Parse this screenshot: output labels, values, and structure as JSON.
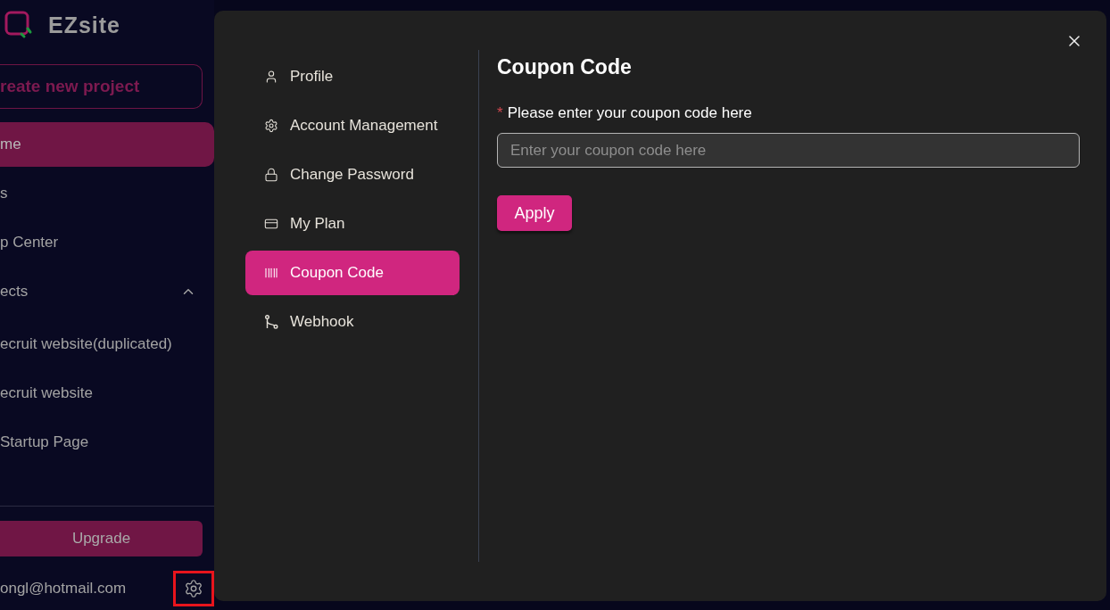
{
  "sidebar": {
    "logo_text": "EZsite",
    "create_button": "reate new project",
    "items": [
      {
        "label": "me",
        "selected": true
      },
      {
        "label": "s",
        "selected": false
      },
      {
        "label": "p Center",
        "selected": false
      },
      {
        "label": "ects",
        "selected": false,
        "expanded": true,
        "children": [
          {
            "label": "ecruit website(duplicated)",
            "selected": false
          },
          {
            "label": "ecruit website",
            "selected": false
          },
          {
            "label": "Startup Page",
            "selected": false
          }
        ]
      }
    ],
    "upgrade_button": "Upgrade",
    "user_email": "ongl@hotmail.com",
    "settings_highlighted": true
  },
  "modal": {
    "nav": [
      {
        "label": "Profile",
        "selected": false
      },
      {
        "label": "Account Management",
        "selected": false
      },
      {
        "label": "Change Password",
        "selected": false
      },
      {
        "label": "My Plan",
        "selected": false
      },
      {
        "label": "Coupon Code",
        "selected": true
      },
      {
        "label": "Webhook",
        "selected": false
      }
    ],
    "title": "Coupon Code",
    "field": {
      "required_mark": "*",
      "label": "Please enter your coupon code here",
      "placeholder": "Enter your coupon code here"
    },
    "apply_button": "Apply"
  }
}
